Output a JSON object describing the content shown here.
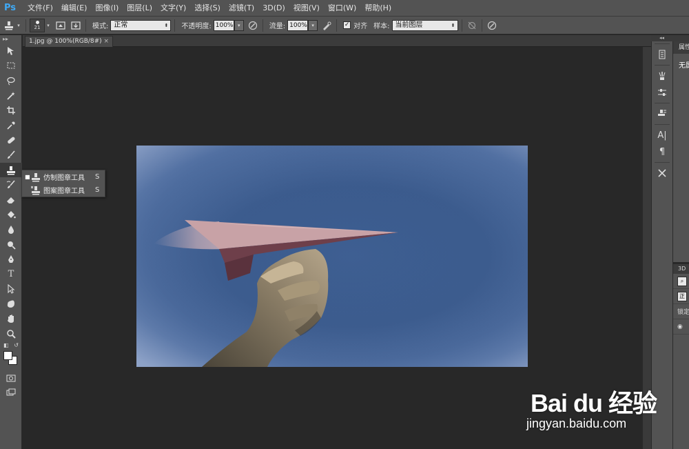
{
  "app": {
    "logo": "Ps"
  },
  "menu": [
    "文件(F)",
    "编辑(E)",
    "图像(I)",
    "图层(L)",
    "文字(Y)",
    "选择(S)",
    "滤镜(T)",
    "3D(D)",
    "视图(V)",
    "窗口(W)",
    "帮助(H)"
  ],
  "options": {
    "brush_size": "21",
    "mode_label": "模式:",
    "mode_value": "正常",
    "opacity_label": "不透明度:",
    "opacity_value": "100%",
    "flow_label": "流量:",
    "flow_value": "100%",
    "align_checked": true,
    "align_label": "对齐",
    "sample_label": "样本:",
    "sample_value": "当前图层"
  },
  "document": {
    "tab_title": "1.jpg @ 100%(RGB/8#)",
    "close_glyph": "×"
  },
  "tools": [
    "move-tool",
    "marquee-tool",
    "lasso-tool",
    "magic-wand-tool",
    "crop-tool",
    "eyedropper-tool",
    "healing-brush-tool",
    "brush-tool",
    "clone-stamp-tool",
    "history-brush-tool",
    "eraser-tool",
    "paint-bucket-tool",
    "blur-tool",
    "dodge-tool",
    "pen-tool",
    "type-tool",
    "path-selection-tool",
    "shape-tool",
    "hand-tool",
    "zoom-tool"
  ],
  "flyout": {
    "items": [
      {
        "label": "仿制图章工具",
        "key": "S",
        "selected": true
      },
      {
        "label": "图案图章工具",
        "key": "S",
        "selected": false
      }
    ]
  },
  "right_panel": {
    "properties_tab": "属性",
    "properties_text": "无属性",
    "layers_tab": "3D",
    "blend_mode": "正",
    "lock_label": "锁定"
  },
  "watermark": {
    "brand": "Bai du 经验",
    "url": "jingyan.baidu.com"
  },
  "colors": {
    "foreground": "#ffffff",
    "background": "#ffffff",
    "ui_panel": "#535353",
    "canvas_bg": "#282828"
  }
}
